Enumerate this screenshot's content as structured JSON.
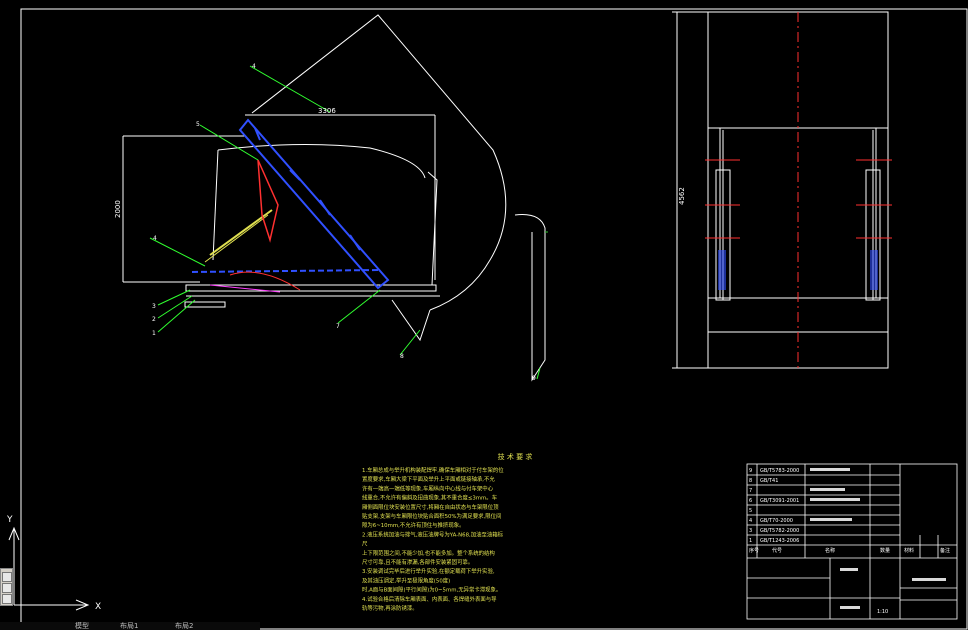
{
  "drawing": {
    "dim_width": "3306",
    "dim_height": "2000",
    "dim_overall_height": "4562",
    "part_callouts": [
      "1",
      "2",
      "3",
      "4",
      "4",
      "5",
      "7",
      "8",
      "9"
    ]
  },
  "ucs": {
    "y_label": "Y",
    "x_label": "X"
  },
  "tech_requirements": {
    "title": "技 术 要 求",
    "lines": [
      "1.车厢总成与举升机构装配焊牢,确保车厢相对于付车架的位",
      "  置度要求,车厢大梁下平面及举升上平面或链接轴承,不允",
      "  许有一端高一端低等现象,车厢纵向中心线与付车架中心",
      "  线重合,不允许有偏斜及扭曲现象,其不重合度≤3mm。车",
      "  厢侧面限位块安装位置尺寸,将厢在自由状态与车架限位顶",
      "  贴支架,支架与车厢限位块贴合面积50%为满足要求,限位间",
      "  隙为6~10mm,不允许有顶住与推挤现象。",
      "2.液压系统加油与排气,液压油牌号为YA-N68,加油至油箱标",
      "  尺",
      "  上下限范围之间,不能少加,也不能多加。整个系统的结构",
      "  尺寸可靠,且不能有渗漏,各部件安装紧固可靠。",
      "3.安装调试完毕后进行举升实验,在额定载荷下举升实验,",
      "  及其油压调定,举升至极限角度(50度)",
      "  时,A面与B面间隙(平行间隙)为0~5mm,无异常卡滞现象。",
      "4.试验合格后清除车厢表面、内表面、各焊缝外表面与导",
      "  轨等污物,再涂防锈漆。"
    ]
  },
  "title_block": {
    "rows": [
      {
        "no": "9",
        "code": "GB/T5783-2000",
        "name": "",
        "qty": "",
        "mat": "",
        "note": ""
      },
      {
        "no": "8",
        "code": "GB/T41",
        "name": "",
        "qty": "",
        "mat": "",
        "note": ""
      },
      {
        "no": "7",
        "code": "",
        "name": "",
        "qty": "",
        "mat": "",
        "note": ""
      },
      {
        "no": "6",
        "code": "GB/T3091-2001",
        "name": "",
        "qty": "",
        "mat": "",
        "note": ""
      },
      {
        "no": "5",
        "code": "",
        "name": "",
        "qty": "",
        "mat": "",
        "note": ""
      },
      {
        "no": "4",
        "code": "GB/T70-2000",
        "name": "",
        "qty": "",
        "mat": "",
        "note": ""
      },
      {
        "no": "3",
        "code": "GB/T5782-2000",
        "name": "",
        "qty": "",
        "mat": "",
        "note": ""
      },
      {
        "no": "1",
        "code": "GB/T1243-2006",
        "name": "",
        "qty": "",
        "mat": "",
        "note": ""
      }
    ],
    "header": {
      "no": "序号",
      "code": "代号",
      "name": "名称",
      "qty": "数量",
      "mat": "材料",
      "note": "备注"
    },
    "sheet": "1:10"
  },
  "status_tabs": [
    "模型",
    "布局1",
    "布局2"
  ]
}
